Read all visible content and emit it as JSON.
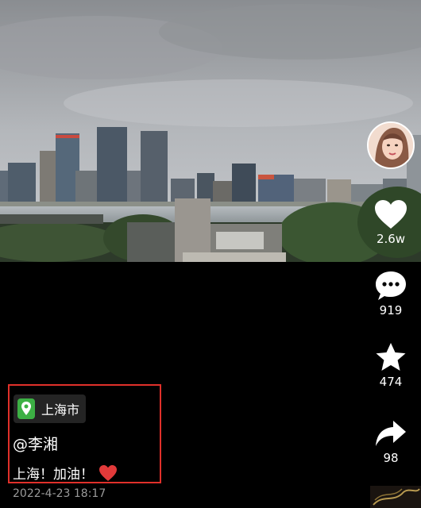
{
  "video": {
    "scene": "city-skyline"
  },
  "actions": {
    "like_count": "2.6w",
    "comment_count": "919",
    "favorite_count": "474",
    "share_count": "98"
  },
  "location": {
    "text": "上海市",
    "pin_color": "#3cb044"
  },
  "post": {
    "author": "@李湘",
    "caption": "上海！加油！",
    "date": "2022-4-23 18:17"
  },
  "colors": {
    "highlight_border": "#e0302a",
    "heart": "#e23a3a"
  }
}
